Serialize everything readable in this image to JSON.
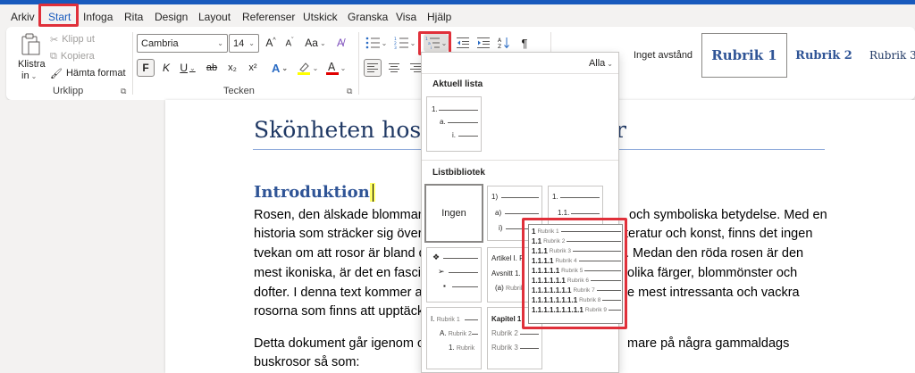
{
  "menu": {
    "tabs": [
      {
        "label": "Arkiv"
      },
      {
        "label": "Start"
      },
      {
        "label": "Infoga"
      },
      {
        "label": "Rita"
      },
      {
        "label": "Design"
      },
      {
        "label": "Layout"
      },
      {
        "label": "Referenser"
      },
      {
        "label": "Utskick"
      },
      {
        "label": "Granska"
      },
      {
        "label": "Visa"
      },
      {
        "label": "Hjälp"
      }
    ],
    "active_tab": "Start"
  },
  "ribbon": {
    "clipboard": {
      "paste_label": "Klistra",
      "paste_label2": "in",
      "cut_label": "Klipp ut",
      "copy_label": "Kopiera",
      "format_painter_label": "Hämta format",
      "group_label": "Urklipp"
    },
    "font": {
      "font_name": "Cambria",
      "font_size": "14",
      "bold": "F",
      "italic": "K",
      "underline": "U",
      "strike": "ab",
      "subscript": "x₂",
      "superscript": "x²",
      "case": "Aa",
      "group_label": "Tecken"
    },
    "styles": [
      {
        "label": "Inget avstånd"
      },
      {
        "label": "Rubrik 1"
      },
      {
        "label": "Rubrik 2"
      },
      {
        "label": "Rubrik 3"
      }
    ]
  },
  "dropdown": {
    "filter_label": "Alla",
    "current_section": "Aktuell lista",
    "library_section": "Listbibliotek",
    "current_list": [
      "1.",
      "a.",
      "i."
    ],
    "none_label": "Ingen",
    "tile_paren": [
      "1)",
      "a)",
      "i)"
    ],
    "tile_dotted": [
      "1.",
      "1.1."
    ],
    "tile_article": [
      "Artikel I.",
      "Avsnitt 1.",
      "(a)"
    ],
    "tile_article_grey": [
      "R",
      "",
      "Rubrik"
    ],
    "tile_roman": [
      "I.",
      "A.",
      "1."
    ],
    "tile_roman_grey": [
      "Rubrik 1",
      "Rubrik 2",
      "Rubrik"
    ],
    "tile_chapter": [
      "Kapitel 1",
      "",
      ""
    ],
    "tile_chapter_grey": [
      "",
      "Rubrik 2",
      "Rubrik 3"
    ]
  },
  "preview": {
    "rows": [
      {
        "num": "1",
        "text": "Rubrik 1"
      },
      {
        "num": "1.1",
        "text": "Rubrik 2"
      },
      {
        "num": "1.1.1",
        "text": "Rubrik 3"
      },
      {
        "num": "1.1.1.1",
        "text": "Rubrik 4"
      },
      {
        "num": "1.1.1.1.1",
        "text": "Rubrik 5"
      },
      {
        "num": "1.1.1.1.1.1",
        "text": "Rubrik 6"
      },
      {
        "num": "1.1.1.1.1.1.1",
        "text": "Rubrik 7"
      },
      {
        "num": "1.1.1.1.1.1.1.1",
        "text": "Rubrik 8"
      },
      {
        "num": "1.1.1.1.1.1.1.1.1",
        "text": "Rubrik 9"
      }
    ]
  },
  "document": {
    "title_visible": "Skönheten hos",
    "title_tail": "r",
    "heading": "Introduktion",
    "para1": [
      {
        "left": "Rosen, den älskade blomman",
        "right": "och symboliska betydelse. Med en"
      },
      {
        "left": "historia som sträcker sig över",
        "right": "teratur och konst, finns det ingen"
      },
      {
        "left": "tvekan om att rosor är bland d",
        "right": ". Medan den röda rosen är den"
      },
      {
        "left": "mest ikoniska, är det en fascin",
        "right": "olika färger, blommönster och"
      },
      {
        "left": "dofter. I denna text kommer a",
        "right": "e mest intressanta och vackra"
      },
      {
        "left": "rosorna som finns att upptäck",
        "right": ""
      }
    ],
    "para2": [
      {
        "left": "Detta dokument går igenom o",
        "right": "mare på några gammaldags"
      },
      {
        "left": "buskrosor så som:",
        "right": ""
      }
    ]
  },
  "colors": {
    "accent": "#185abd",
    "annotation": "#e0303a",
    "heading": "#2f5496",
    "highlight": "#ffff66"
  }
}
